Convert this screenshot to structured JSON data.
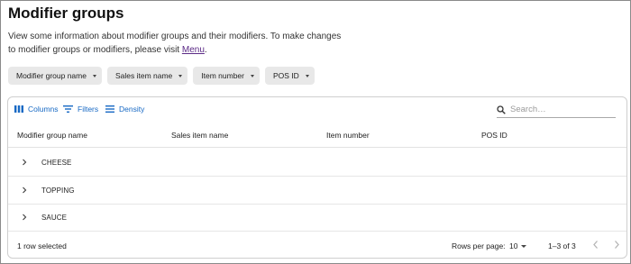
{
  "page": {
    "title": "Modifier groups",
    "description_text": "View some information about modifier groups and their modifiers. To make changes to modifier groups or modifiers, please visit ",
    "description_link": "Menu",
    "description_end": "."
  },
  "filters": [
    {
      "label": "Modifier group name"
    },
    {
      "label": "Sales item name"
    },
    {
      "label": "Item number"
    },
    {
      "label": "POS ID"
    }
  ],
  "toolbar": {
    "columns_label": "Columns",
    "filters_label": "Filters",
    "density_label": "Density",
    "search_placeholder": "Search…"
  },
  "table": {
    "columns": [
      "Modifier group name",
      "Sales item name",
      "Item number",
      "POS ID"
    ],
    "rows": [
      {
        "name": "CHEESE"
      },
      {
        "name": "TOPPING"
      },
      {
        "name": "SAUCE"
      }
    ]
  },
  "footer": {
    "selection_text": "1 row selected",
    "rows_per_page_label": "Rows per page:",
    "rows_per_page_value": "10",
    "range_text": "1–3 of 3"
  },
  "colors": {
    "accent": "#1769c4",
    "link": "#5b2a86",
    "chip_bg": "#e8e8e8"
  }
}
